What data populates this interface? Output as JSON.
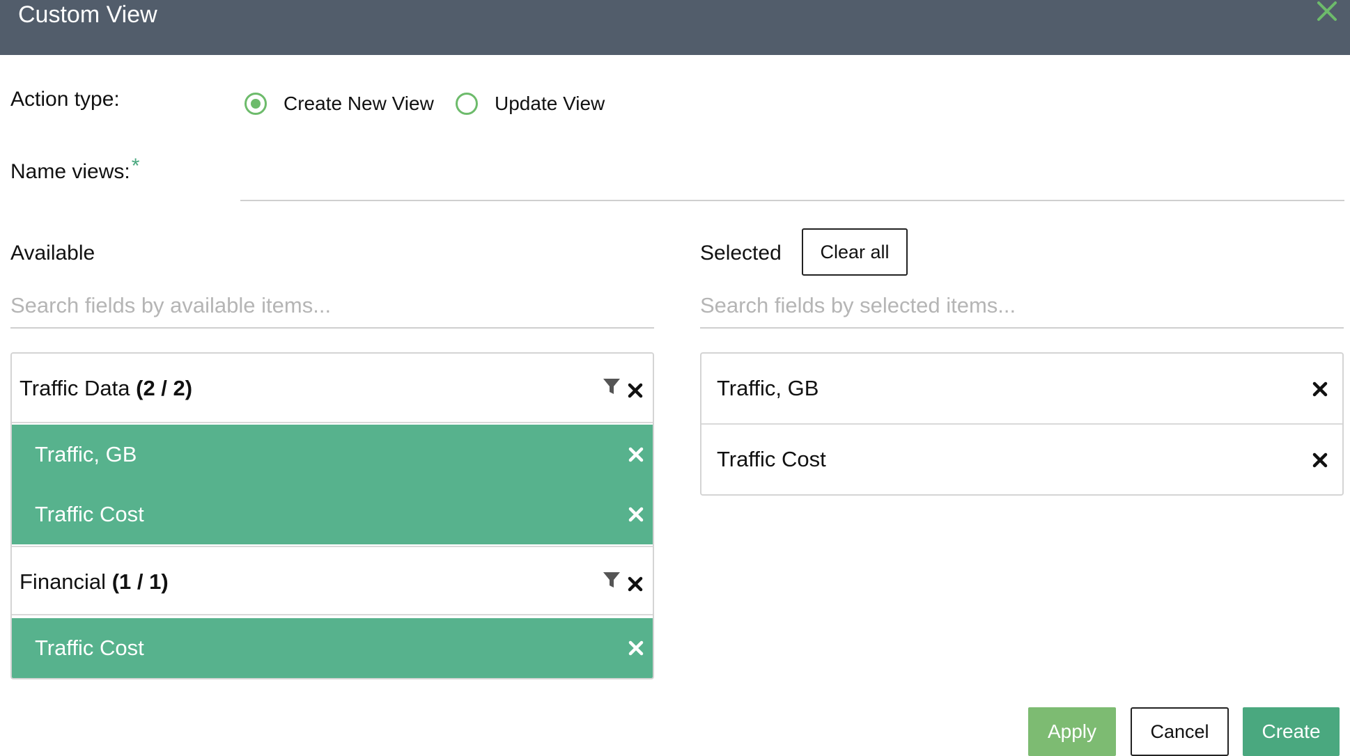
{
  "dialog": {
    "title": "Custom View",
    "close_icon": "close-icon"
  },
  "action_type": {
    "label": "Action type:",
    "options": [
      {
        "label": "Create New View",
        "checked": true
      },
      {
        "label": "Update View",
        "checked": false
      }
    ]
  },
  "name_views": {
    "label": "Name views:",
    "required_mark": "*",
    "value": ""
  },
  "available": {
    "heading": "Available",
    "search_placeholder": "Search fields by available items...",
    "groups": [
      {
        "name": "Traffic Data",
        "count": "(2 / 2)",
        "items": [
          "Traffic, GB",
          "Traffic Cost"
        ]
      },
      {
        "name": "Financial",
        "count": "(1 / 1)",
        "items": [
          "Traffic Cost"
        ]
      }
    ]
  },
  "selected": {
    "heading": "Selected",
    "clear_all_label": "Clear all",
    "search_placeholder": "Search fields by selected items...",
    "items": [
      "Traffic, GB",
      "Traffic Cost"
    ]
  },
  "footer": {
    "apply_label": "Apply",
    "cancel_label": "Cancel",
    "create_label": "Create"
  },
  "colors": {
    "header_bg": "#525d6b",
    "accent_green": "#57b28d",
    "radio_green": "#6dbb6b",
    "apply_green": "#7dbb72",
    "create_green": "#4aa87f"
  }
}
